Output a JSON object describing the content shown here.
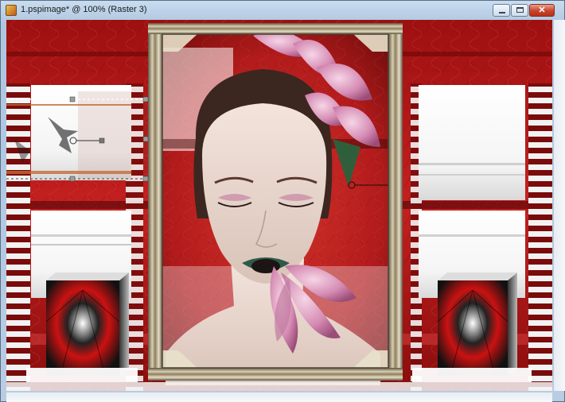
{
  "window": {
    "title": "1.pspimage* @ 100% (Raster 3)"
  },
  "controls": {
    "minimize_icon": "minimize-icon",
    "maximize_icon": "maximize-icon",
    "close_icon": "close-icon",
    "close_glyph": "✕"
  },
  "artwork": {
    "colors": {
      "red_dark": "#7a0b0b",
      "red": "#b01818",
      "red_light": "#d63a34",
      "white": "#ffffff",
      "frame_gold": "#8f7e5e"
    }
  }
}
